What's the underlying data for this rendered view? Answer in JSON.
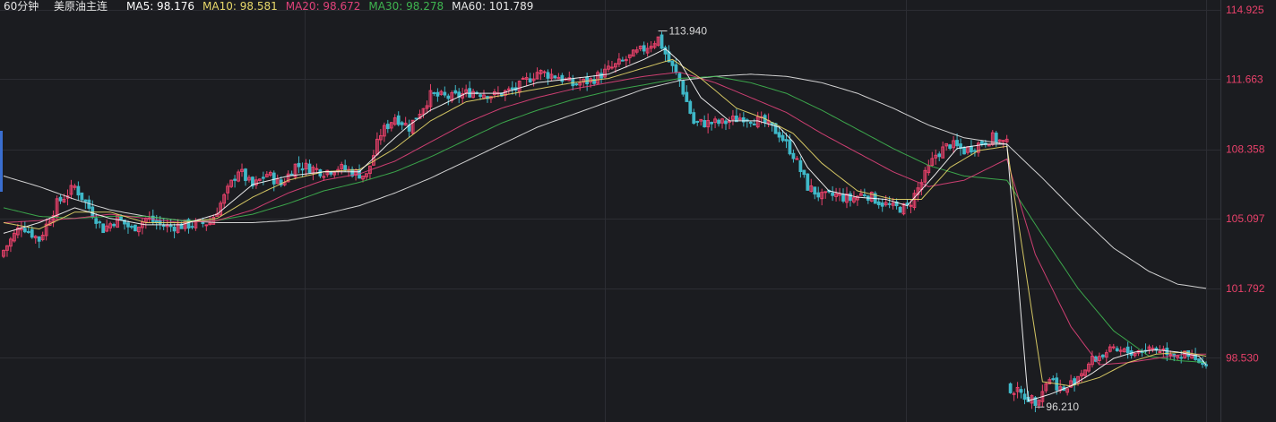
{
  "header": {
    "period": "60分钟",
    "symbol": "美原油主连",
    "ma": [
      {
        "label": "MA5",
        "value": "98.176",
        "color": "#ffffff"
      },
      {
        "label": "MA10",
        "value": "98.581",
        "color": "#e8d86a"
      },
      {
        "label": "MA20",
        "value": "98.672",
        "color": "#e0427a"
      },
      {
        "label": "MA30",
        "value": "98.278",
        "color": "#3fb550"
      },
      {
        "label": "MA60",
        "value": "101.789",
        "color": "#e6e6e6"
      }
    ]
  },
  "colors": {
    "background": "#1b1c20",
    "grid": "#2c2d33",
    "up": "#e8416a",
    "down": "#3fb8c8",
    "axis_text": "#e8416a",
    "annotation": "#d8d8d8"
  },
  "chart_data": {
    "type": "candlestick",
    "title": "美原油主连 60分钟",
    "y_axis": {
      "position": "right",
      "ticks": [
        114.925,
        111.663,
        108.358,
        105.097,
        101.792,
        98.53
      ],
      "tick_labels": [
        "114.925",
        "111.663",
        "108.358",
        "105.097",
        "101.792",
        "98.530"
      ],
      "range": [
        95.5,
        115.4
      ]
    },
    "annotations": [
      {
        "label": "113.940",
        "value": 113.94,
        "type": "high"
      },
      {
        "label": "96.210",
        "value": 96.21,
        "type": "low"
      }
    ],
    "series_anchors": {
      "close": [
        [
          0,
          103.6
        ],
        [
          5,
          104.8
        ],
        [
          10,
          104.1
        ],
        [
          15,
          105.8
        ],
        [
          20,
          106.6
        ],
        [
          24,
          105.6
        ],
        [
          28,
          104.6
        ],
        [
          32,
          105.1
        ],
        [
          36,
          104.6
        ],
        [
          40,
          105.1
        ],
        [
          46,
          104.7
        ],
        [
          52,
          104.8
        ],
        [
          58,
          104.9
        ],
        [
          62,
          106.1
        ],
        [
          66,
          107.4
        ],
        [
          70,
          106.6
        ],
        [
          74,
          107.2
        ],
        [
          78,
          106.7
        ],
        [
          82,
          107.6
        ],
        [
          86,
          107.5
        ],
        [
          90,
          107.3
        ],
        [
          94,
          107.5
        ],
        [
          98,
          107.3
        ],
        [
          102,
          107.1
        ],
        [
          106,
          109.1
        ],
        [
          110,
          109.9
        ],
        [
          114,
          109.4
        ],
        [
          120,
          110.9
        ],
        [
          126,
          110.8
        ],
        [
          132,
          111.1
        ],
        [
          138,
          110.9
        ],
        [
          144,
          111.2
        ],
        [
          150,
          112.0
        ],
        [
          156,
          111.8
        ],
        [
          160,
          111.4
        ],
        [
          165,
          111.6
        ],
        [
          170,
          112.1
        ],
        [
          175,
          112.6
        ],
        [
          180,
          113.1
        ],
        [
          184,
          113.6
        ],
        [
          187,
          112.5
        ],
        [
          190,
          111.6
        ],
        [
          194,
          109.6
        ],
        [
          198,
          109.6
        ],
        [
          202,
          109.6
        ],
        [
          208,
          109.9
        ],
        [
          214,
          109.6
        ],
        [
          218,
          109.1
        ],
        [
          222,
          108.1
        ],
        [
          226,
          106.6
        ],
        [
          230,
          106.1
        ],
        [
          234,
          106.2
        ],
        [
          238,
          106.0
        ],
        [
          242,
          106.3
        ],
        [
          246,
          105.9
        ],
        [
          250,
          105.6
        ],
        [
          254,
          105.6
        ],
        [
          258,
          106.8
        ],
        [
          262,
          108.1
        ],
        [
          266,
          108.6
        ],
        [
          270,
          108.3
        ],
        [
          274,
          108.6
        ],
        [
          278,
          108.9
        ],
        [
          282,
          108.6
        ],
        [
          283,
          97.1
        ],
        [
          286,
          96.8
        ],
        [
          290,
          96.5
        ],
        [
          294,
          97.6
        ],
        [
          298,
          96.9
        ],
        [
          302,
          97.7
        ],
        [
          306,
          98.4
        ],
        [
          310,
          98.8
        ],
        [
          314,
          98.8
        ],
        [
          318,
          98.8
        ],
        [
          322,
          99.0
        ],
        [
          326,
          98.9
        ],
        [
          330,
          98.7
        ],
        [
          334,
          98.5
        ],
        [
          338,
          98.0
        ]
      ],
      "ma5": [
        [
          0,
          104.4
        ],
        [
          10,
          104.9
        ],
        [
          20,
          105.6
        ],
        [
          30,
          105.1
        ],
        [
          40,
          104.8
        ],
        [
          50,
          104.8
        ],
        [
          60,
          105.3
        ],
        [
          70,
          106.7
        ],
        [
          80,
          107.1
        ],
        [
          90,
          107.3
        ],
        [
          100,
          107.3
        ],
        [
          108,
          108.6
        ],
        [
          114,
          109.5
        ],
        [
          120,
          110.2
        ],
        [
          130,
          111.0
        ],
        [
          140,
          111.0
        ],
        [
          150,
          111.5
        ],
        [
          160,
          111.7
        ],
        [
          170,
          111.9
        ],
        [
          180,
          112.6
        ],
        [
          186,
          113.1
        ],
        [
          190,
          112.5
        ],
        [
          196,
          110.8
        ],
        [
          204,
          109.7
        ],
        [
          212,
          109.7
        ],
        [
          218,
          109.4
        ],
        [
          222,
          108.7
        ],
        [
          226,
          107.5
        ],
        [
          232,
          106.4
        ],
        [
          240,
          106.1
        ],
        [
          248,
          106.0
        ],
        [
          254,
          105.7
        ],
        [
          262,
          107.2
        ],
        [
          268,
          108.4
        ],
        [
          276,
          108.6
        ],
        [
          282,
          108.6
        ],
        [
          288,
          96.5
        ],
        [
          294,
          96.8
        ],
        [
          300,
          97.2
        ],
        [
          306,
          97.8
        ],
        [
          312,
          98.5
        ],
        [
          318,
          98.8
        ],
        [
          324,
          98.9
        ],
        [
          330,
          98.8
        ],
        [
          336,
          98.6
        ],
        [
          338,
          98.2
        ]
      ],
      "ma10": [
        [
          0,
          104.9
        ],
        [
          10,
          104.6
        ],
        [
          20,
          105.4
        ],
        [
          30,
          105.4
        ],
        [
          40,
          104.9
        ],
        [
          50,
          104.9
        ],
        [
          60,
          105.1
        ],
        [
          70,
          106.1
        ],
        [
          80,
          106.9
        ],
        [
          90,
          107.3
        ],
        [
          100,
          107.4
        ],
        [
          110,
          108.4
        ],
        [
          120,
          109.7
        ],
        [
          130,
          110.6
        ],
        [
          140,
          110.9
        ],
        [
          150,
          111.2
        ],
        [
          160,
          111.5
        ],
        [
          170,
          111.7
        ],
        [
          180,
          112.2
        ],
        [
          188,
          112.6
        ],
        [
          196,
          111.7
        ],
        [
          206,
          110.3
        ],
        [
          214,
          109.8
        ],
        [
          222,
          109.1
        ],
        [
          230,
          107.7
        ],
        [
          240,
          106.4
        ],
        [
          250,
          106.0
        ],
        [
          258,
          106.0
        ],
        [
          266,
          107.5
        ],
        [
          274,
          108.3
        ],
        [
          282,
          108.5
        ],
        [
          292,
          97.4
        ],
        [
          300,
          97.2
        ],
        [
          308,
          97.6
        ],
        [
          316,
          98.3
        ],
        [
          324,
          98.7
        ],
        [
          332,
          98.8
        ],
        [
          338,
          98.6
        ]
      ],
      "ma20": [
        [
          0,
          104.9
        ],
        [
          10,
          105.0
        ],
        [
          20,
          105.1
        ],
        [
          30,
          105.3
        ],
        [
          40,
          105.1
        ],
        [
          50,
          104.9
        ],
        [
          60,
          105.0
        ],
        [
          70,
          105.5
        ],
        [
          80,
          106.3
        ],
        [
          90,
          106.9
        ],
        [
          100,
          107.2
        ],
        [
          110,
          107.8
        ],
        [
          120,
          108.7
        ],
        [
          130,
          109.6
        ],
        [
          140,
          110.3
        ],
        [
          150,
          110.8
        ],
        [
          160,
          111.2
        ],
        [
          170,
          111.5
        ],
        [
          180,
          111.8
        ],
        [
          190,
          112.0
        ],
        [
          200,
          111.5
        ],
        [
          210,
          110.8
        ],
        [
          220,
          110.1
        ],
        [
          230,
          109.1
        ],
        [
          240,
          108.2
        ],
        [
          250,
          107.3
        ],
        [
          260,
          106.6
        ],
        [
          270,
          106.9
        ],
        [
          282,
          107.9
        ],
        [
          290,
          103.4
        ],
        [
          300,
          100.0
        ],
        [
          308,
          98.2
        ],
        [
          316,
          98.3
        ],
        [
          324,
          98.5
        ],
        [
          332,
          98.7
        ],
        [
          338,
          98.7
        ]
      ],
      "ma30": [
        [
          0,
          105.6
        ],
        [
          10,
          105.2
        ],
        [
          20,
          105.1
        ],
        [
          30,
          105.2
        ],
        [
          40,
          105.2
        ],
        [
          50,
          105.0
        ],
        [
          60,
          105.0
        ],
        [
          70,
          105.3
        ],
        [
          80,
          105.8
        ],
        [
          90,
          106.4
        ],
        [
          100,
          106.8
        ],
        [
          110,
          107.3
        ],
        [
          120,
          108.0
        ],
        [
          130,
          108.8
        ],
        [
          140,
          109.6
        ],
        [
          150,
          110.2
        ],
        [
          160,
          110.7
        ],
        [
          170,
          111.1
        ],
        [
          180,
          111.4
        ],
        [
          190,
          111.7
        ],
        [
          200,
          111.8
        ],
        [
          210,
          111.5
        ],
        [
          220,
          111.0
        ],
        [
          230,
          110.2
        ],
        [
          240,
          109.3
        ],
        [
          250,
          108.4
        ],
        [
          260,
          107.6
        ],
        [
          270,
          107.1
        ],
        [
          282,
          106.9
        ],
        [
          292,
          104.3
        ],
        [
          302,
          101.8
        ],
        [
          312,
          99.8
        ],
        [
          322,
          98.6
        ],
        [
          330,
          98.4
        ],
        [
          338,
          98.3
        ]
      ],
      "ma60": [
        [
          0,
          107.1
        ],
        [
          10,
          106.6
        ],
        [
          20,
          106.0
        ],
        [
          30,
          105.5
        ],
        [
          40,
          105.2
        ],
        [
          50,
          105.0
        ],
        [
          60,
          104.9
        ],
        [
          70,
          104.9
        ],
        [
          80,
          105.0
        ],
        [
          90,
          105.3
        ],
        [
          100,
          105.7
        ],
        [
          110,
          106.3
        ],
        [
          120,
          107.0
        ],
        [
          130,
          107.8
        ],
        [
          140,
          108.6
        ],
        [
          150,
          109.4
        ],
        [
          160,
          110.0
        ],
        [
          170,
          110.6
        ],
        [
          180,
          111.2
        ],
        [
          190,
          111.6
        ],
        [
          200,
          111.8
        ],
        [
          210,
          111.9
        ],
        [
          220,
          111.8
        ],
        [
          230,
          111.5
        ],
        [
          240,
          111.0
        ],
        [
          250,
          110.3
        ],
        [
          260,
          109.5
        ],
        [
          270,
          108.9
        ],
        [
          282,
          108.6
        ],
        [
          292,
          107.0
        ],
        [
          302,
          105.3
        ],
        [
          312,
          103.7
        ],
        [
          322,
          102.6
        ],
        [
          330,
          102.0
        ],
        [
          338,
          101.8
        ]
      ]
    }
  }
}
